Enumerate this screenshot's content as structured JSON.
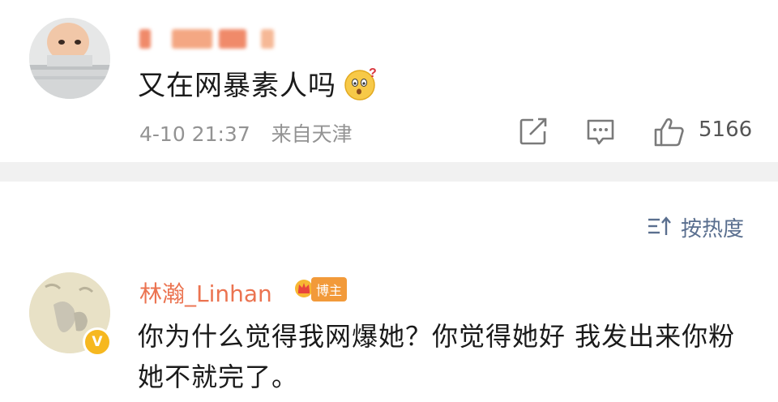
{
  "post": {
    "text": "又在网暴素人吗",
    "emoji": "surprised-emoji",
    "date": "4-10 21:37",
    "location": "来自天津",
    "like_count": "5166"
  },
  "sort": {
    "label": "按热度"
  },
  "reply": {
    "username": "林瀚_Linhan",
    "badge_label": "博主",
    "text": "你为什么觉得我网爆她？你觉得她好 我发出来你粉她不就完了。"
  },
  "colors": {
    "username_orange": "#eb7350",
    "sort_blue": "#5a6f8f",
    "meta_gray": "#939393",
    "divider": "#f1f1f1",
    "verify_yellow": "#f6b820"
  }
}
